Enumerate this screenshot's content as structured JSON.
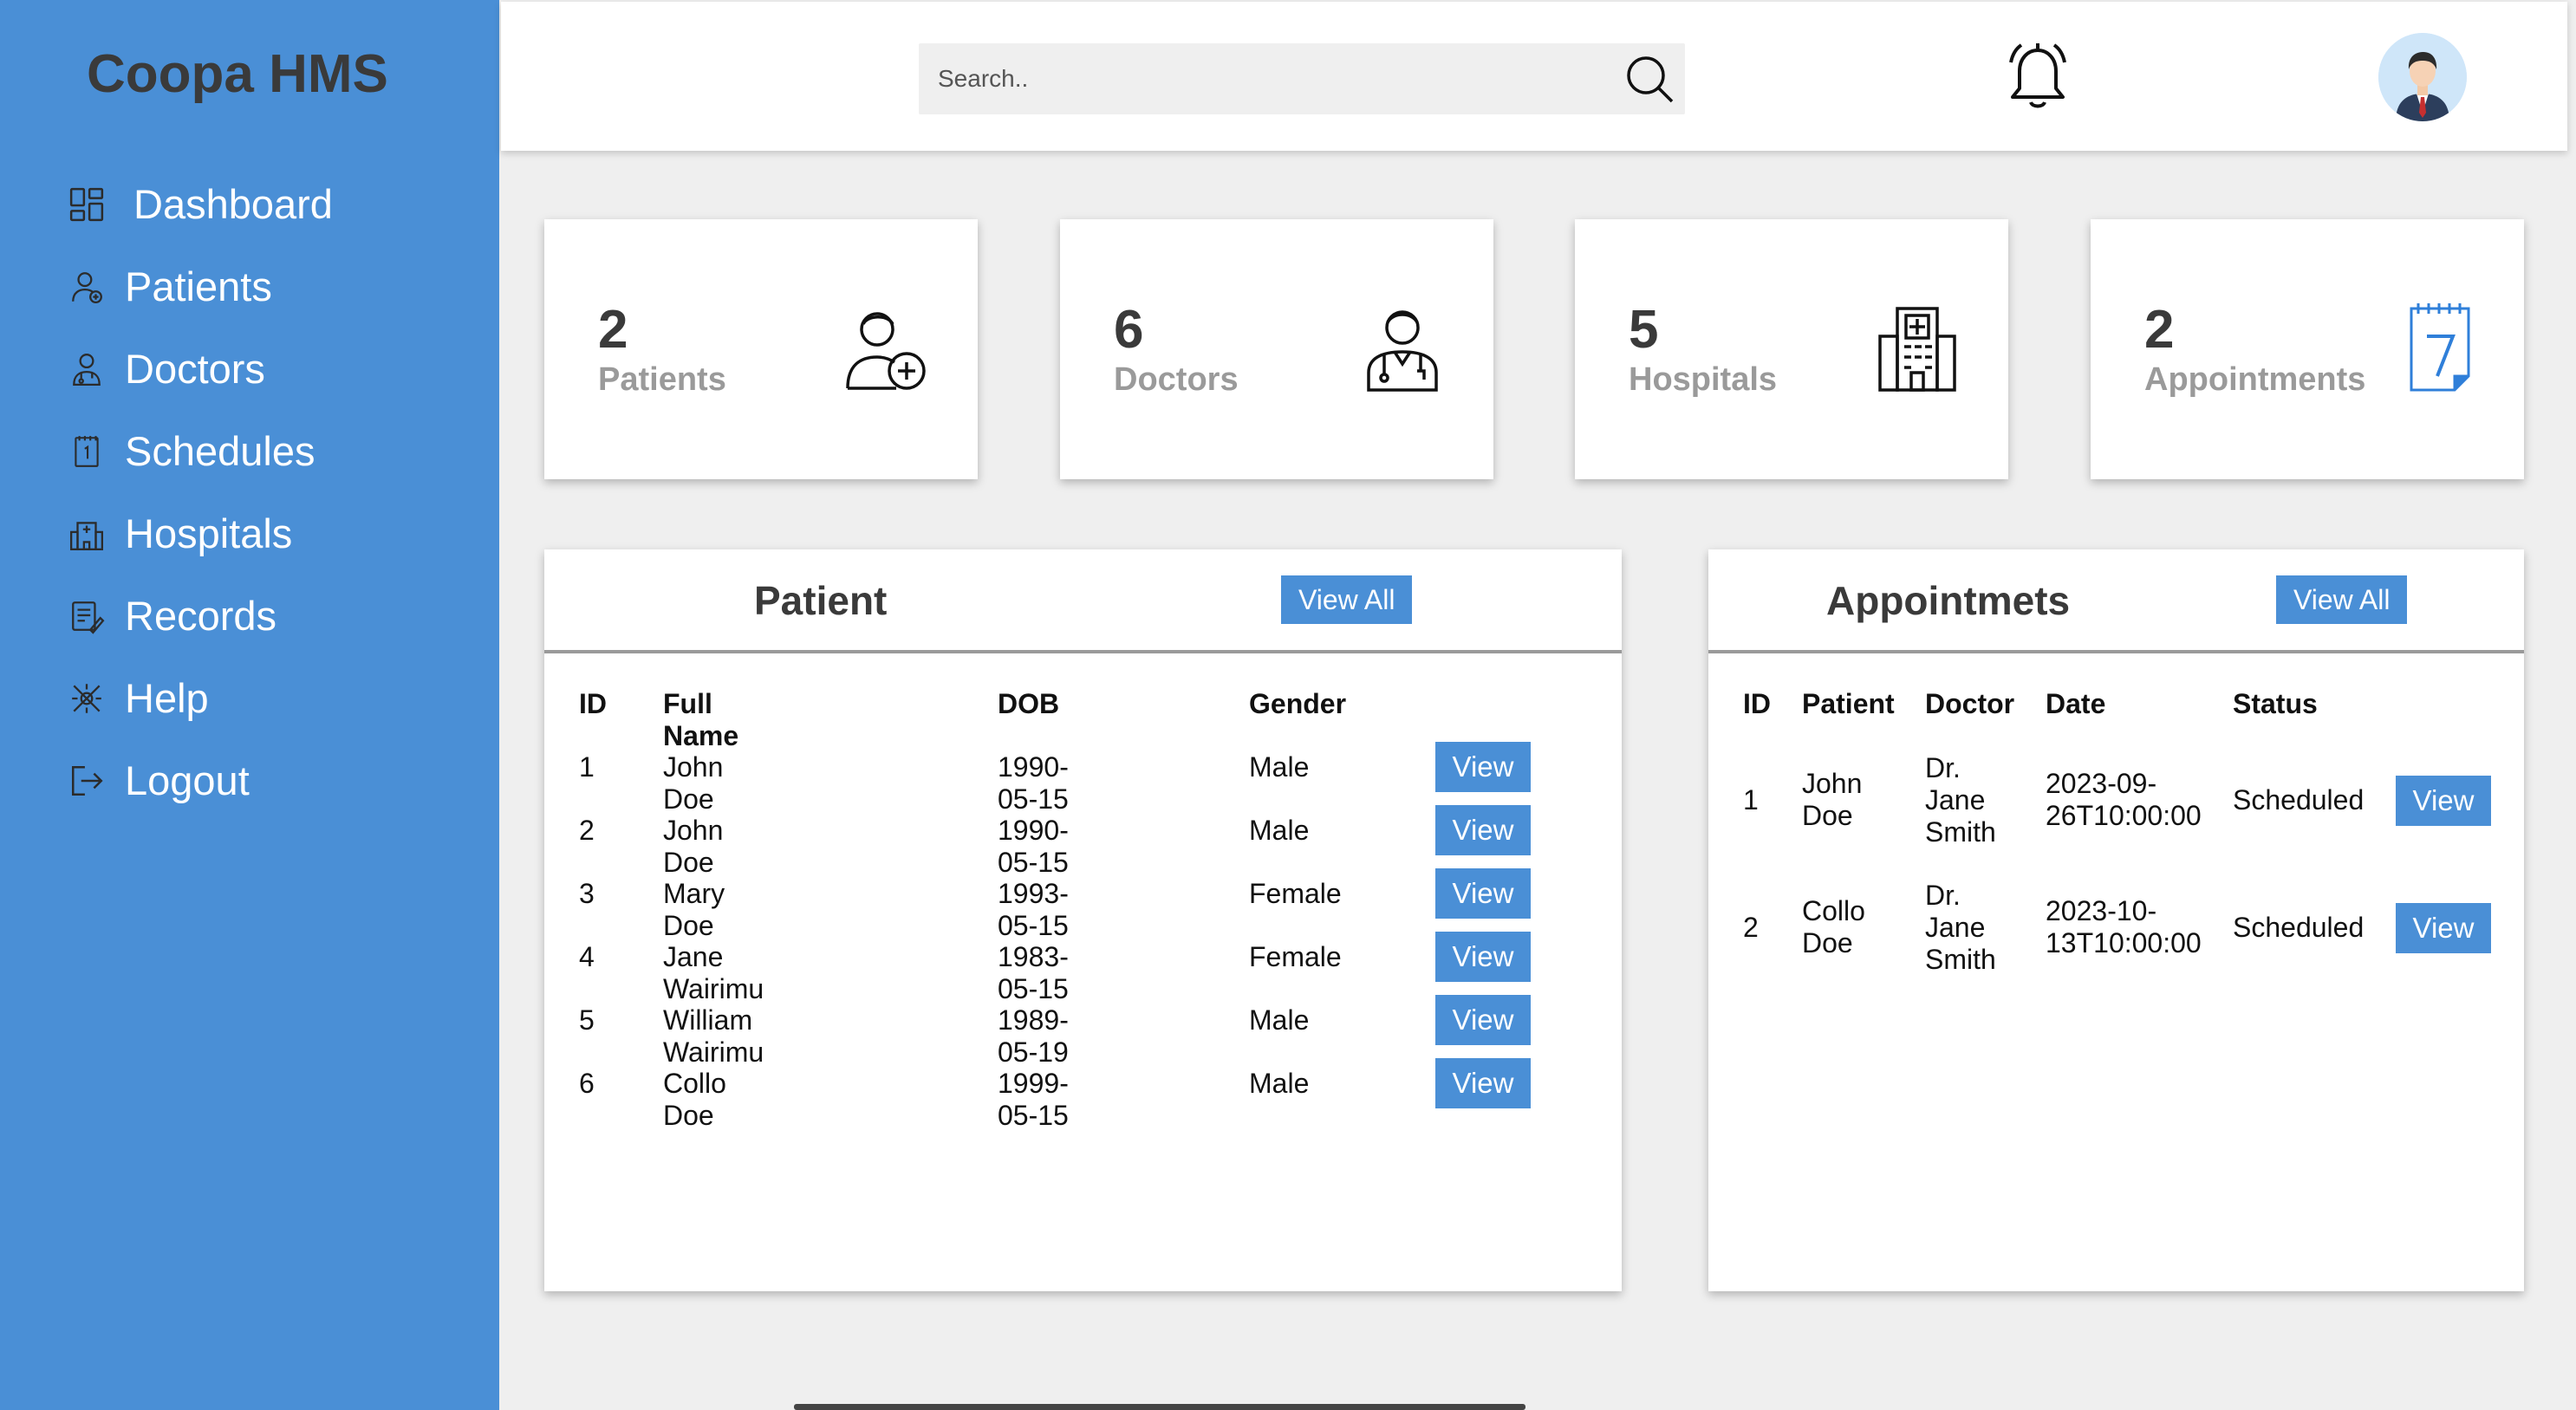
{
  "app": {
    "brand": "Coopa HMS"
  },
  "sidebar": {
    "items": [
      {
        "label": "Dashboard",
        "icon": "dashboard-icon"
      },
      {
        "label": "Patients",
        "icon": "patient-icon"
      },
      {
        "label": "Doctors",
        "icon": "doctor-icon"
      },
      {
        "label": "Schedules",
        "icon": "calendar-icon"
      },
      {
        "label": "Hospitals",
        "icon": "hospital-icon"
      },
      {
        "label": "Records",
        "icon": "records-icon"
      },
      {
        "label": "Help",
        "icon": "help-icon"
      },
      {
        "label": "Logout",
        "icon": "logout-icon"
      }
    ]
  },
  "topbar": {
    "search_placeholder": "Search..",
    "icons": [
      "search-icon",
      "bell-icon",
      "avatar"
    ]
  },
  "stats": [
    {
      "count": "2",
      "label": "Patients",
      "icon": "patient-plus-icon"
    },
    {
      "count": "6",
      "label": "Doctors",
      "icon": "doctor-icon"
    },
    {
      "count": "5",
      "label": "Hospitals",
      "icon": "hospital-icon"
    },
    {
      "count": "2",
      "label": "Appointments",
      "icon": "calendar-7-icon"
    }
  ],
  "patients_panel": {
    "title": "Patient",
    "view_all": "View All",
    "headers": [
      "ID",
      "Full Name",
      "DOB",
      "Gender"
    ],
    "rows": [
      {
        "id": "1",
        "name": "John Doe",
        "dob": "1990-05-15",
        "gender": "Male",
        "action": "View"
      },
      {
        "id": "2",
        "name": "John Doe",
        "dob": "1990-05-15",
        "gender": "Male",
        "action": "View"
      },
      {
        "id": "3",
        "name": "Mary Doe",
        "dob": "1993-05-15",
        "gender": "Female",
        "action": "View"
      },
      {
        "id": "4",
        "name": "Jane Wairimu",
        "dob": "1983-05-15",
        "gender": "Female",
        "action": "View"
      },
      {
        "id": "5",
        "name": "William Wairimu",
        "dob": "1989-05-19",
        "gender": "Male",
        "action": "View"
      },
      {
        "id": "6",
        "name": "Collo Doe",
        "dob": "1999-05-15",
        "gender": "Male",
        "action": "View"
      }
    ]
  },
  "appointments_panel": {
    "title": "Appointmets",
    "view_all": "View All",
    "headers": [
      "ID",
      "Patient",
      "Doctor",
      "Date",
      "Status"
    ],
    "rows": [
      {
        "id": "1",
        "patient": [
          "John",
          "Doe"
        ],
        "doctor": [
          "Dr.",
          "Jane",
          "Smith"
        ],
        "date": [
          "2023-09-",
          "26T10:00:00"
        ],
        "status": "Scheduled",
        "action": "View"
      },
      {
        "id": "2",
        "patient": [
          "Collo",
          "Doe"
        ],
        "doctor": [
          "Dr.",
          "Jane",
          "Smith"
        ],
        "date": [
          "2023-10-",
          "13T10:00:00"
        ],
        "status": "Scheduled",
        "action": "View"
      }
    ]
  },
  "colors": {
    "primary": "#4a8fd6",
    "text_dark": "#3a3a3a",
    "text_muted": "#9a9a9a",
    "background": "#efefef"
  }
}
